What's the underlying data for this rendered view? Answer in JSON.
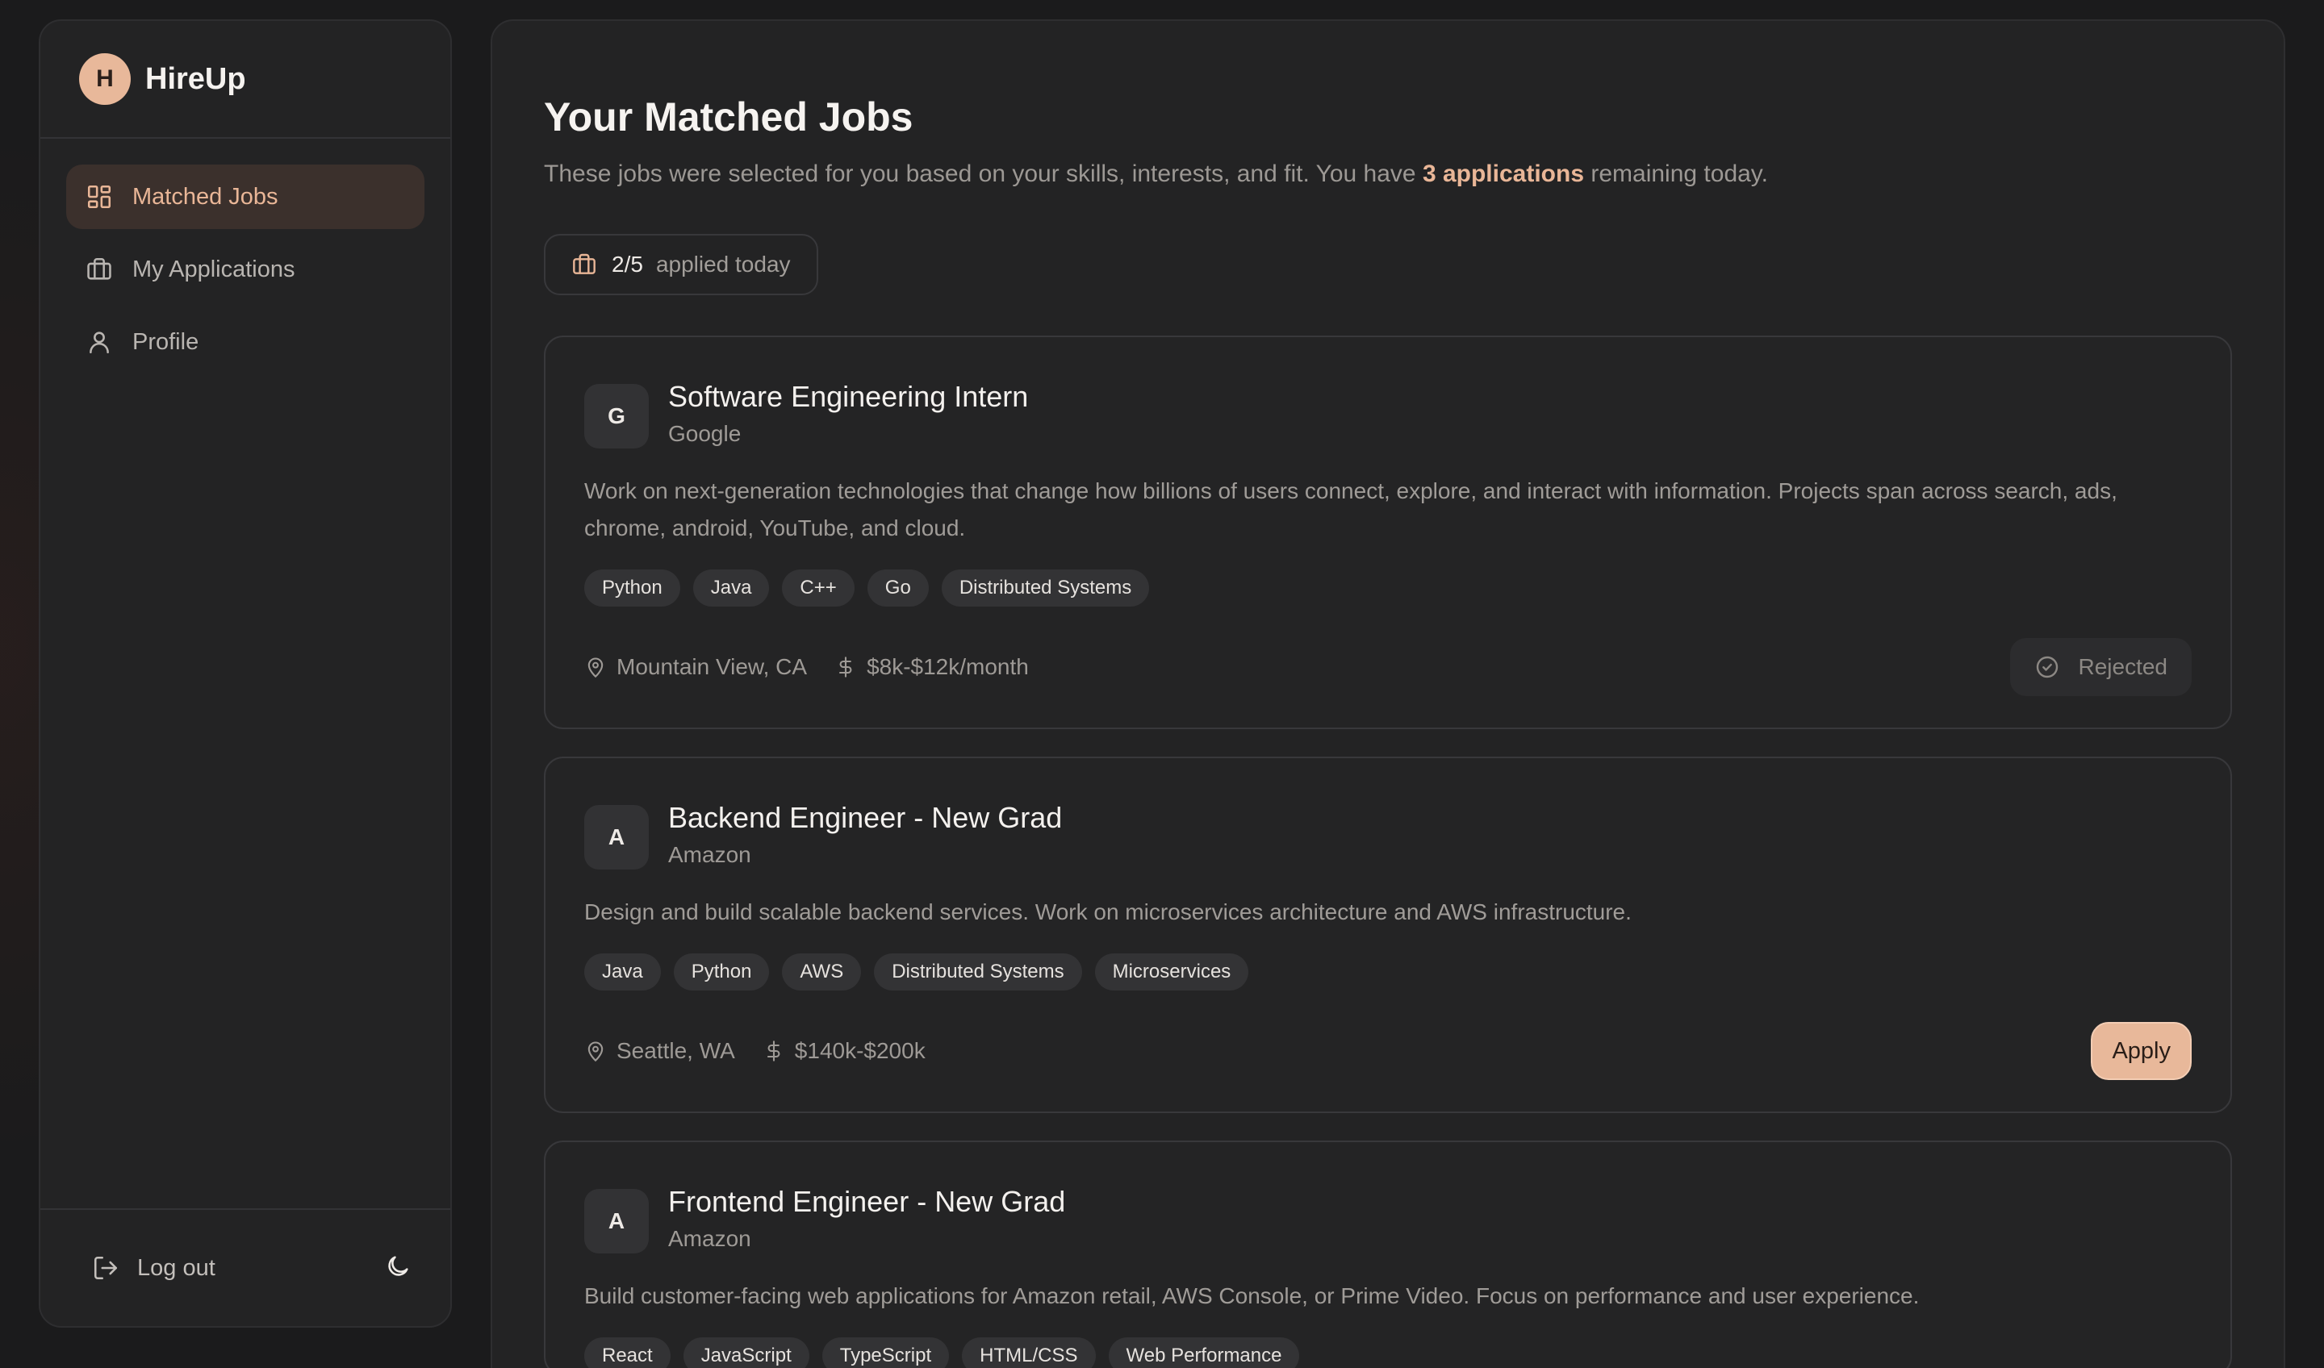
{
  "brand": {
    "initial": "H",
    "name": "HireUp"
  },
  "sidebar": {
    "items": [
      {
        "label": "Matched Jobs",
        "icon": "grid-icon",
        "active": true
      },
      {
        "label": "My Applications",
        "icon": "briefcase-icon",
        "active": false
      },
      {
        "label": "Profile",
        "icon": "user-icon",
        "active": false
      }
    ],
    "logout_label": "Log out",
    "theme_icon": "moon-icon"
  },
  "page": {
    "title": "Your Matched Jobs",
    "subtitle_before": "These jobs were selected for you based on your skills, interests, and fit. You have ",
    "subtitle_highlight": "3 applications",
    "subtitle_after": " remaining today.",
    "applied_count": "2/5",
    "applied_label": "applied today"
  },
  "jobs": [
    {
      "initial": "G",
      "title": "Software Engineering Intern",
      "company": "Google",
      "description": "Work on next-generation technologies that change how billions of users connect, explore, and interact with information. Projects span across search, ads, chrome, android, YouTube, and cloud.",
      "tags": [
        "Python",
        "Java",
        "C++",
        "Go",
        "Distributed Systems"
      ],
      "location": "Mountain View, CA",
      "salary": "$8k-$12k/month",
      "status": "Rejected"
    },
    {
      "initial": "A",
      "title": "Backend Engineer - New Grad",
      "company": "Amazon",
      "description": "Design and build scalable backend services. Work on microservices architecture and AWS infrastructure.",
      "tags": [
        "Java",
        "Python",
        "AWS",
        "Distributed Systems",
        "Microservices"
      ],
      "location": "Seattle, WA",
      "salary": "$140k-$200k",
      "action": "Apply"
    },
    {
      "initial": "A",
      "title": "Frontend Engineer - New Grad",
      "company": "Amazon",
      "description": "Build customer-facing web applications for Amazon retail, AWS Console, or Prime Video. Focus on performance and user experience.",
      "tags": [
        "React",
        "JavaScript",
        "TypeScript",
        "HTML/CSS",
        "Web Performance"
      ]
    }
  ],
  "colors": {
    "accent": "#e8b89a",
    "accent_text": "#e9b697",
    "surface": "#232324",
    "background": "#1b1b1c"
  }
}
